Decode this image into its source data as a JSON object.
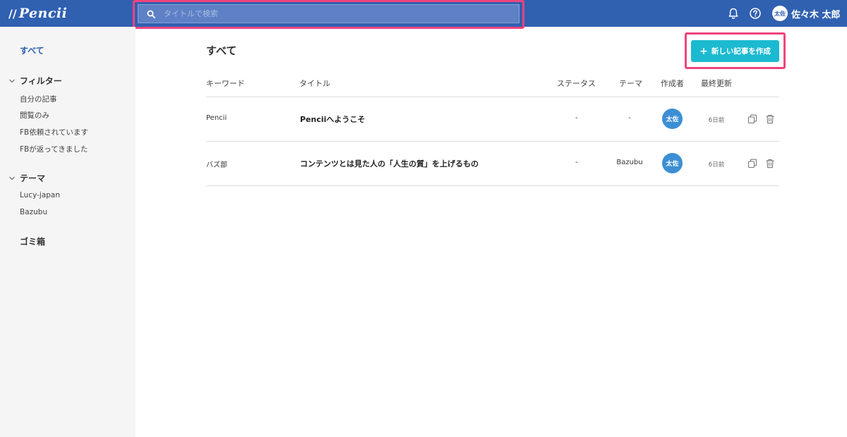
{
  "header": {
    "logo_mark": "//",
    "logo_text": "Pencii",
    "search": {
      "placeholder": "タイトルで検索",
      "value": ""
    },
    "user": {
      "avatar_initials": "太佐",
      "name": "佐々木 太郎"
    },
    "icons": [
      "bell-icon",
      "help-icon",
      "search-icon"
    ],
    "color": "#3060b0"
  },
  "sidebar": {
    "all_label": "すべて",
    "filter": {
      "label": "フィルター",
      "items": [
        "自分の記事",
        "閲覧のみ",
        "FB依頼されています",
        "FBが返ってきました"
      ]
    },
    "theme": {
      "label": "テーマ",
      "items": [
        "Lucy-japan",
        "Bazubu"
      ]
    },
    "trash_label": "ゴミ箱"
  },
  "main": {
    "title": "すべて",
    "create_button": "新しい記事を作成",
    "columns": {
      "keyword": "キーワード",
      "title": "タイトル",
      "status": "ステータス",
      "theme": "テーマ",
      "author": "作成者",
      "updated": "最終更新"
    },
    "rows": [
      {
        "keyword": "Pencii",
        "title": "Penciiへようこそ",
        "status": "-",
        "theme": "-",
        "author": "太佐",
        "updated": "6日前"
      },
      {
        "keyword": "バズ部",
        "title": "コンテンツとは見た人の「人生の質」を上げるもの",
        "status": "-",
        "theme": "Bazubu",
        "author": "太佐",
        "updated": "6日前"
      }
    ]
  },
  "colors": {
    "accent_button": "#1cbad0",
    "avatar": "#3c8fd4",
    "highlight": "#f0437e",
    "sidebar_active": "#2a5fb0"
  }
}
